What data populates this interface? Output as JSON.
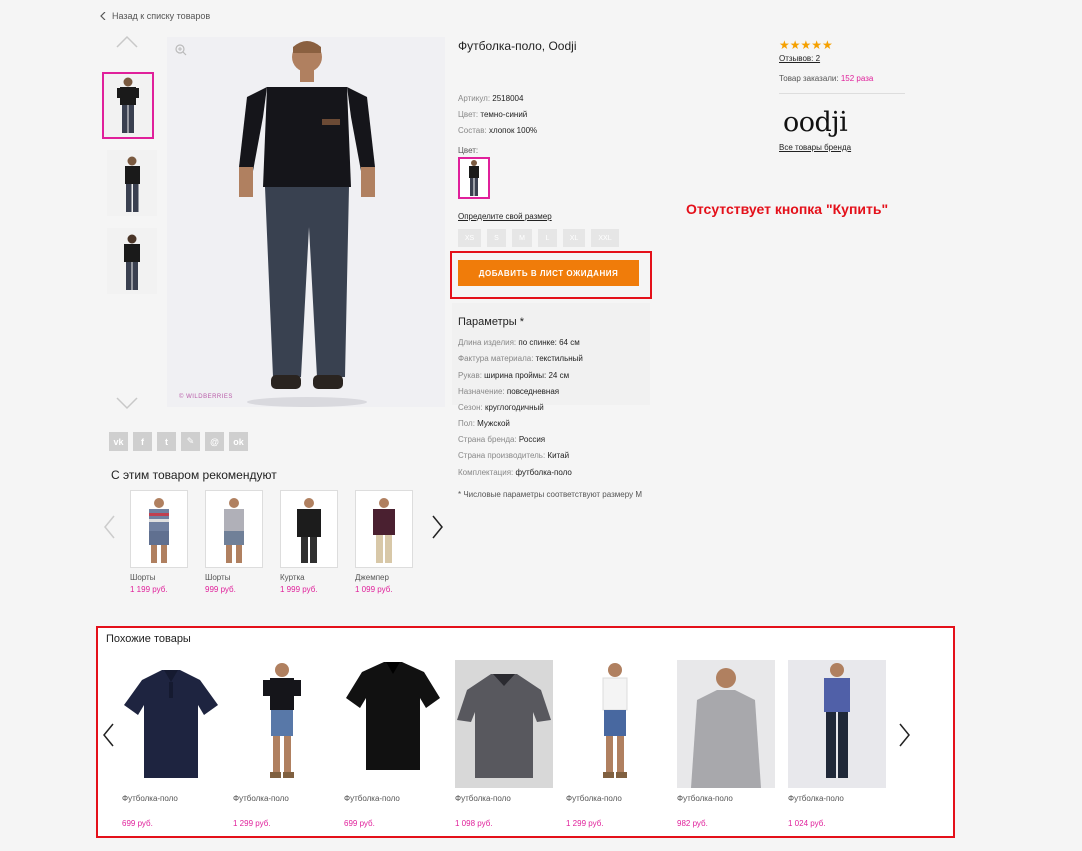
{
  "nav": {
    "back_label": "Назад к списку товаров"
  },
  "product": {
    "title": "Футболка-поло, Oodji",
    "watermark": "© WILDBERRIES",
    "attributes": [
      {
        "label": "Артикул:",
        "value": "2518004"
      },
      {
        "label": "Цвет:",
        "value": "темно-синий"
      },
      {
        "label": "Состав:",
        "value": "хлопок 100%"
      }
    ],
    "color_label": "Цвет:",
    "size_link": "Определите свой размер",
    "sizes": [
      "XS",
      "S",
      "M",
      "L",
      "XL",
      "XXL"
    ],
    "waitlist_button": "ДОБАВИТЬ В ЛИСТ ОЖИДАНИЯ",
    "params_title": "Параметры *",
    "params": [
      {
        "label": "Длина изделия:",
        "value": "по спинке: 64 см"
      },
      {
        "label": "Фактура материала:",
        "value": "текстильный"
      },
      {
        "label": "Рукав:",
        "value": "ширина проймы: 24 см"
      },
      {
        "label": "Назначение:",
        "value": "повседневная"
      },
      {
        "label": "Сезон:",
        "value": "круглогодичный"
      },
      {
        "label": "Пол:",
        "value": "Мужской"
      },
      {
        "label": "Страна бренда:",
        "value": "Россия"
      },
      {
        "label": "Страна производитель:",
        "value": "Китай"
      },
      {
        "label": "Комплектация:",
        "value": "футболка-поло"
      }
    ],
    "footnote": "* Числовые параметры соответствуют размеру M"
  },
  "rating": {
    "stars": "★★★★★",
    "reviews": "Отзывов: 2",
    "ordered_prefix": "Товар заказали:",
    "ordered_count": "152 раза"
  },
  "brand": {
    "logo_text": "oodji",
    "all_link": "Все товары бренда"
  },
  "annotation": {
    "callout": "Отсутствует кнопка \"Купить\""
  },
  "social": [
    "vk",
    "f",
    "t",
    "✎",
    "@",
    "ok"
  ],
  "recommended": {
    "title": "С этим товаром рекомендуют",
    "items": [
      {
        "name": "Шорты",
        "price": "1 199 руб."
      },
      {
        "name": "Шорты",
        "price": "999 руб."
      },
      {
        "name": "Куртка",
        "price": "1 999 руб."
      },
      {
        "name": "Джемпер",
        "price": "1 099 руб."
      }
    ]
  },
  "similar": {
    "title": "Похожие товары",
    "items": [
      {
        "name": "Футболка-поло",
        "price": "699 руб."
      },
      {
        "name": "Футболка-поло",
        "price": "1 299 руб."
      },
      {
        "name": "Футболка-поло",
        "price": "699 руб."
      },
      {
        "name": "Футболка-поло",
        "price": "1 098 руб."
      },
      {
        "name": "Футболка-поло",
        "price": "1 299 руб."
      },
      {
        "name": "Футболка-поло",
        "price": "982 руб."
      },
      {
        "name": "Футболка-поло",
        "price": "1 024 руб."
      }
    ]
  },
  "colors": {
    "accent_pink": "#e0209b",
    "orange": "#f07c0a",
    "highlight_red": "#e4101a",
    "star": "#f5a000"
  }
}
